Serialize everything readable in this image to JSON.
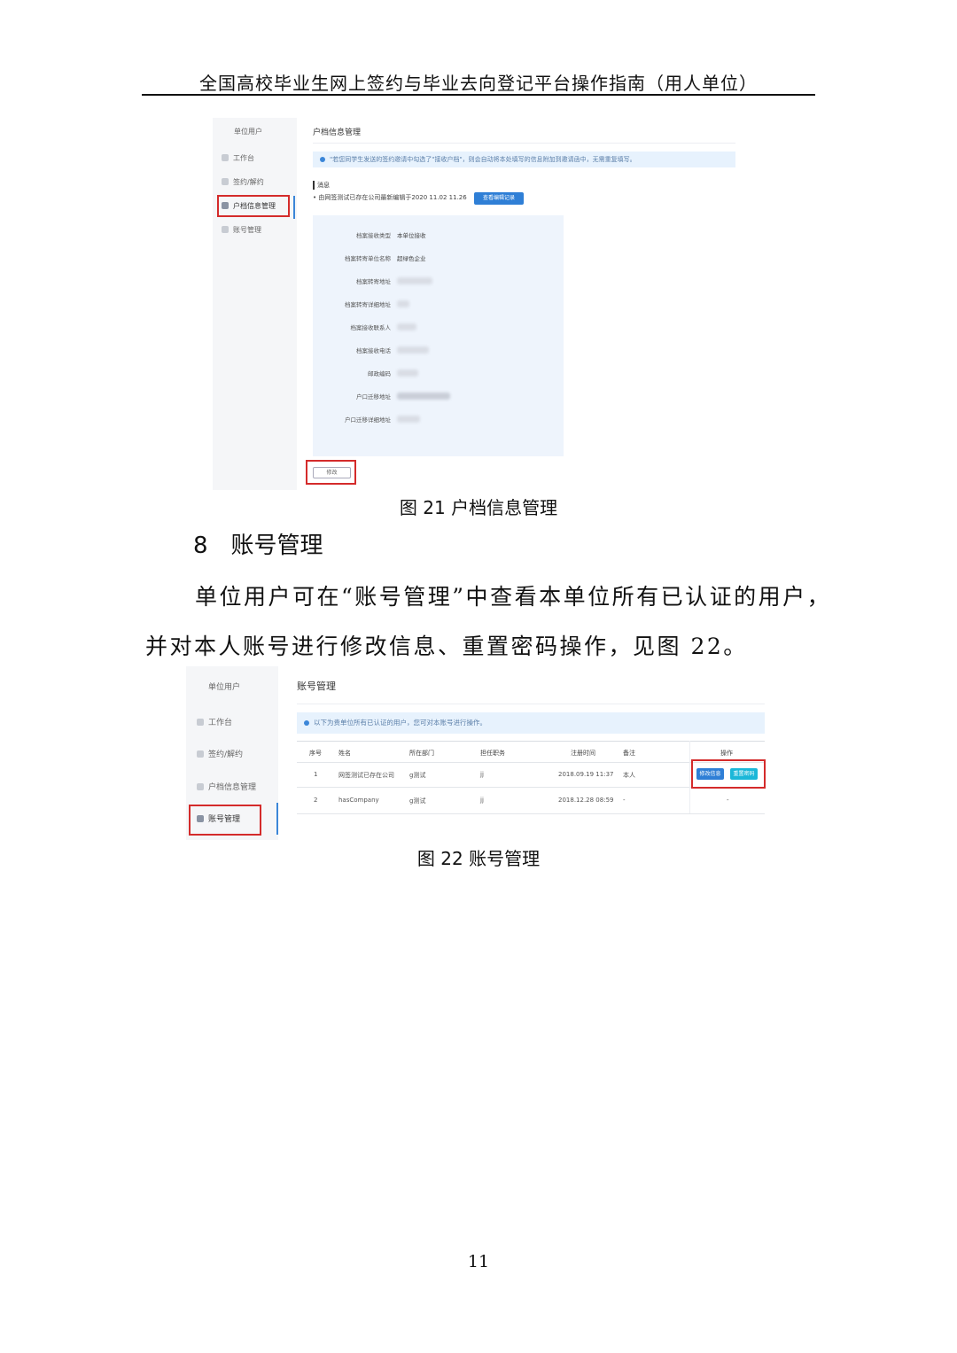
{
  "header": {
    "title": "全国高校毕业生网上签约与毕业去向登记平台操作指南（用人单位）"
  },
  "fig21": {
    "sidebar": {
      "section": "单位用户",
      "items": [
        "工作台",
        "签约/解约",
        "户档信息管理",
        "账号管理"
      ]
    },
    "page_title": "户档信息管理",
    "notice": "\"若您同学生发送的签约邀请中勾选了\"接收户档\"，则会自动将本处填写的信息附加到邀请函中，无需重复填写。",
    "message_label": "消息",
    "message_text": "• 由网签测试已存在公司最新编辑于2020 11.02 11.26",
    "view_edit_button": "查看编辑记录",
    "fields": [
      {
        "label": "档案接收类型",
        "value": "本单位接收"
      },
      {
        "label": "档案转寄单位名称",
        "value": "超绿色企业"
      },
      {
        "label": "档案转寄地址",
        "value": ""
      },
      {
        "label": "档案转寄详细地址",
        "value": ""
      },
      {
        "label": "档案接收联系人",
        "value": ""
      },
      {
        "label": "档案接收电话",
        "value": ""
      },
      {
        "label": "邮政编码",
        "value": ""
      },
      {
        "label": "户口迁移地址",
        "value": ""
      },
      {
        "label": "户口迁移详细地址",
        "value": ""
      }
    ],
    "edit_button": "修改",
    "caption": "图 21  户档信息管理"
  },
  "section": {
    "number": "8",
    "title": "账号管理"
  },
  "paragraph": {
    "line1": "单位用户可在“账号管理”中查看本单位所有已认证的用户，",
    "line2": "并对本人账号进行修改信息、重置密码操作，见图 22。"
  },
  "fig22": {
    "sidebar": {
      "section": "单位用户",
      "items": [
        "工作台",
        "签约/解约",
        "户档信息管理",
        "账号管理"
      ]
    },
    "page_title": "账号管理",
    "notice": "以下为贵单位所有已认证的用户，您可对本账号进行操作。",
    "columns": [
      "序号",
      "姓名",
      "所在部门",
      "担任职务",
      "注册时间",
      "备注",
      "操作"
    ],
    "rows": [
      {
        "no": "1",
        "name": "网签测试已存在公司",
        "dept": "g测试",
        "post": "jj",
        "time": "2018.09.19 11:37",
        "note": "本人",
        "op1": "修改信息",
        "op2": "重置密码"
      },
      {
        "no": "2",
        "name": "hasCompany",
        "dept": "g测试",
        "post": "jj",
        "time": "2018.12.28 08:59",
        "note": "-",
        "op": "-"
      }
    ],
    "caption": "图 22  账号管理"
  },
  "page_number": "11"
}
